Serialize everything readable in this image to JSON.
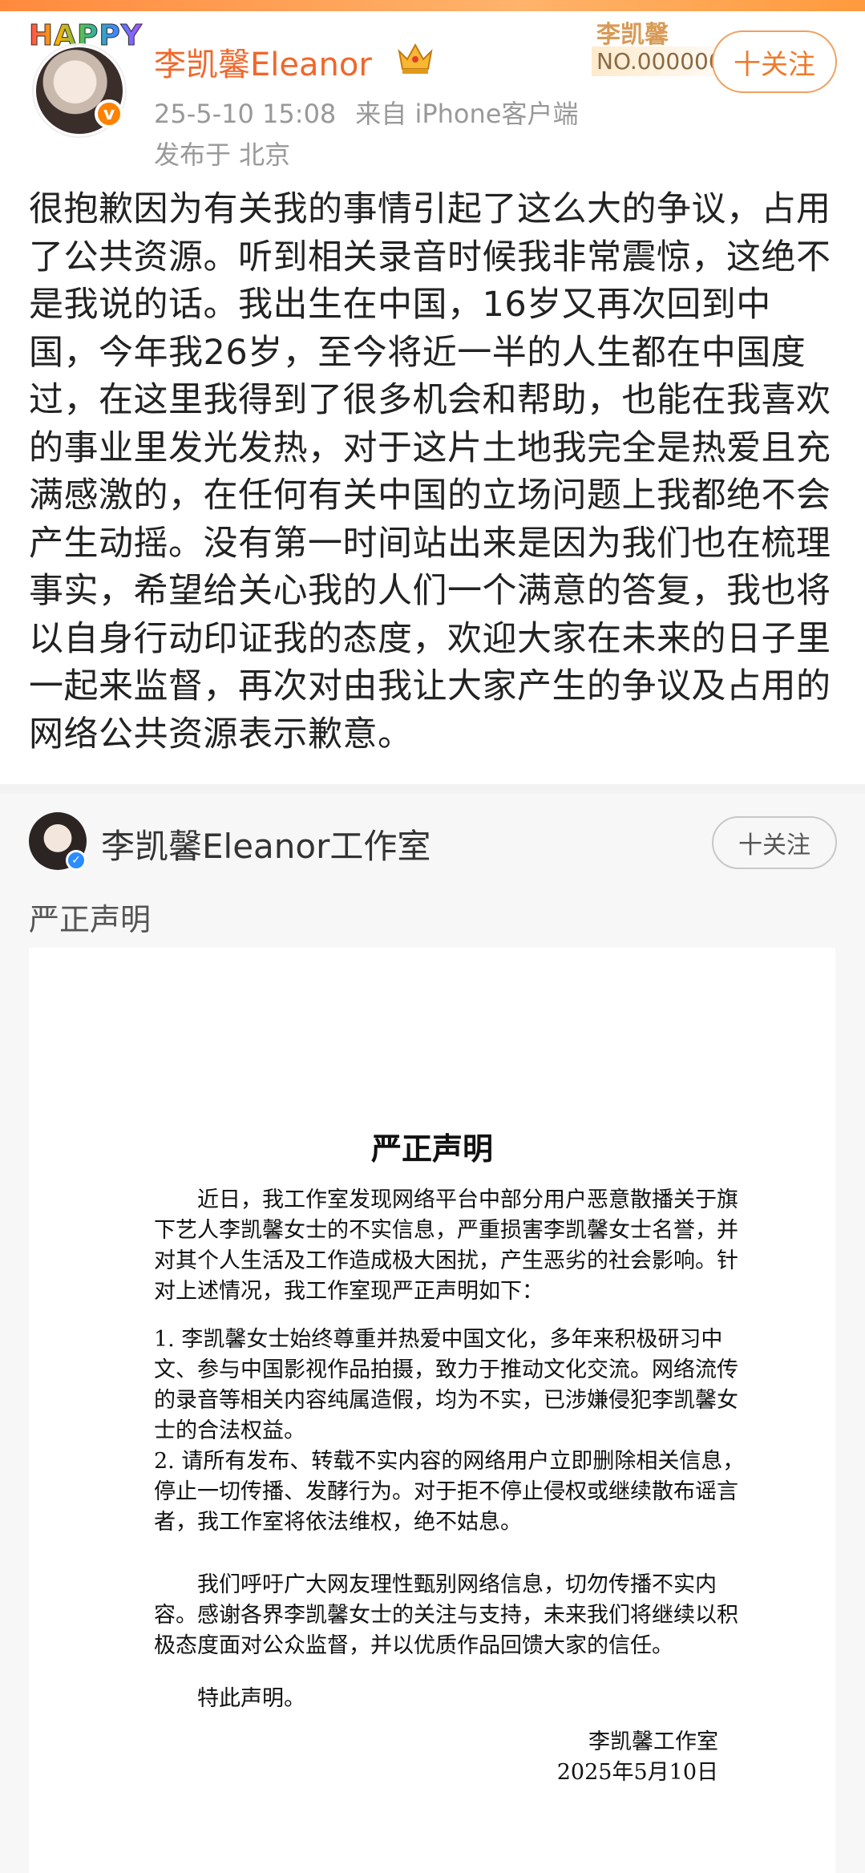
{
  "post": {
    "happy_badge": "HAPPY",
    "author": "李凯馨Eleanor",
    "verified_mark": "v",
    "timestamp": "25-5-10 15:08",
    "source": "来自 iPhone客户端",
    "location": "发布于 北京",
    "fan_card": {
      "name": "李凯馨",
      "number": "NO.000000"
    },
    "follow_label": "十关注",
    "body": "很抱歉因为有关我的事情引起了这么大的争议，占用了公共资源。听到相关录音时候我非常震惊，这绝不是我说的话。我出生在中国，16岁又再次回到中国，今年我26岁，至今将近一半的人生都在中国度过，在这里我得到了很多机会和帮助，也能在我喜欢的事业里发光发热，对于这片土地我完全是热爱且充满感激的，在任何有关中国的立场问题上我都绝不会产生动摇。没有第一时间站出来是因为我们也在梳理事实，希望给关心我的人们一个满意的答复，我也将以自身行动印证我的态度，欢迎大家在未来的日子里一起来监督，再次对由我让大家产生的争议及占用的网络公共资源表示歉意。"
  },
  "repost": {
    "author": "李凯馨Eleanor工作室",
    "follow_label": "十关注",
    "text": "严正声明",
    "document": {
      "title": "严正声明",
      "para1": "近日，我工作室发现网络平台中部分用户恶意散播关于旗下艺人李凯馨女士的不实信息，严重损害李凯馨女士名誉，并对其个人生活及工作造成极大困扰，产生恶劣的社会影响。针对上述情况，我工作室现严正声明如下：",
      "item1": "1. 李凯馨女士始终尊重并热爱中国文化，多年来积极研习中文、参与中国影视作品拍摄，致力于推动文化交流。网络流传的录音等相关内容纯属造假，均为不实，已涉嫌侵犯李凯馨女士的合法权益。",
      "item2": "2. 请所有发布、转载不实内容的网络用户立即删除相关信息，停止一切传播、发酵行为。对于拒不停止侵权或继续散布谣言者，我工作室将依法维权，绝不姑息。",
      "para2": "我们呼吁广大网友理性甄别网络信息，切勿传播不实内容。感谢各界李凯馨女士的关注与支持，未来我们将继续以积极态度面对公众监督，并以优质作品回馈大家的信任。",
      "closing": "特此声明。",
      "signature": "李凯馨工作室",
      "date": "2025年5月10日"
    }
  },
  "colors": {
    "username": "#f0672a",
    "follow_border": "#f0a060",
    "verified_orange": "#ff8200",
    "verified_blue": "#2a8cff"
  }
}
